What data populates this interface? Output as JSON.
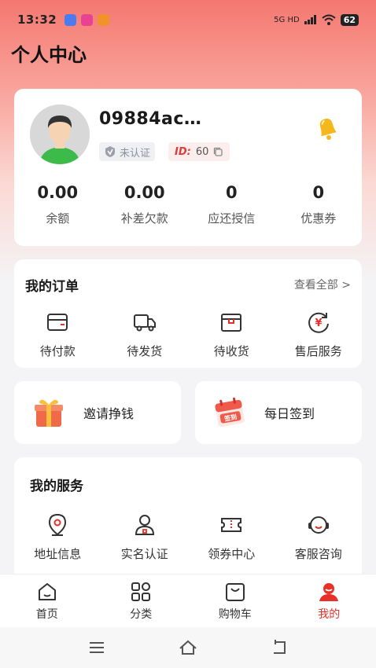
{
  "status_bar": {
    "time": "13:32",
    "network": "5G HD",
    "battery": "62"
  },
  "page_title": "个人中心",
  "profile": {
    "username": "09884ac…",
    "verify_status": "未认证",
    "id_label": "ID:",
    "id_value": "60"
  },
  "stats": [
    {
      "value": "0.00",
      "label": "余额"
    },
    {
      "value": "0.00",
      "label": "补差欠款"
    },
    {
      "value": "0",
      "label": "应还授信"
    },
    {
      "value": "0",
      "label": "优惠券"
    }
  ],
  "orders": {
    "title": "我的订单",
    "view_all": "查看全部 >",
    "items": [
      {
        "label": "待付款",
        "icon": "wallet-icon"
      },
      {
        "label": "待发货",
        "icon": "truck-icon"
      },
      {
        "label": "待收货",
        "icon": "box-icon"
      },
      {
        "label": "售后服务",
        "icon": "yen-refresh-icon"
      }
    ]
  },
  "promos": [
    {
      "label": "邀请挣钱",
      "icon": "gift-icon"
    },
    {
      "label": "每日签到",
      "icon": "calendar-icon",
      "icon_text": "签到"
    }
  ],
  "services": {
    "title": "我的服务",
    "items": [
      {
        "label": "地址信息",
        "icon": "location-pin-icon"
      },
      {
        "label": "实名认证",
        "icon": "user-id-icon"
      },
      {
        "label": "领券中心",
        "icon": "coupon-icon"
      },
      {
        "label": "客服咨询",
        "icon": "headset-icon"
      }
    ]
  },
  "tabbar": {
    "items": [
      {
        "label": "首页",
        "icon": "home-icon"
      },
      {
        "label": "分类",
        "icon": "grid-icon"
      },
      {
        "label": "购物车",
        "icon": "bag-icon"
      },
      {
        "label": "我的",
        "icon": "user-icon",
        "active": true
      }
    ]
  },
  "colors": {
    "accent": "#e8302a",
    "header_gradient_top": "#f47870"
  }
}
